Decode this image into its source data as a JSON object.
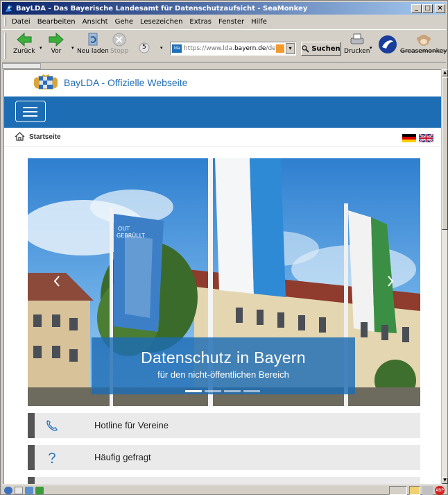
{
  "window": {
    "title": "BayLDA - Das Bayerische Landesamt für Datenschutzaufsicht - SeaMonkey",
    "buttons": {
      "minimize": "_",
      "maximize": "□",
      "close": "×"
    }
  },
  "menu": {
    "items": [
      "Datei",
      "Bearbeiten",
      "Ansicht",
      "Gehe",
      "Lesezeichen",
      "Extras",
      "Fenster",
      "Hilfe"
    ]
  },
  "toolbar": {
    "back": "Zurück",
    "forward": "Vor",
    "reload": "Neu laden",
    "stop": "Stopp",
    "history_count": "5",
    "url_prefix": "https://www.lda.",
    "url_domain": "bayern.de",
    "url_suffix": "/de",
    "search": "Suchen",
    "print": "Drucken",
    "greasemonkey": "Greasemonkey"
  },
  "page": {
    "site_title": "BayLDA - Offizielle Webseite",
    "breadcrumb": "Startseite",
    "hero": {
      "heading": "Datenschutz in Bayern",
      "subheading": "für den nicht-öffentlichen Bereich",
      "flag_text_line1": "OUT",
      "flag_text_line2": "GEBRÜLLT",
      "slides": 4,
      "active_slide": 1
    },
    "quick_links": [
      {
        "label": "Hotline für Vereine",
        "icon": "phone-icon"
      },
      {
        "label": "Häufig gefragt",
        "icon": "question-icon"
      }
    ]
  },
  "colors": {
    "brand_blue": "#1d6db5",
    "quicklink_bg": "#eaeaea",
    "quicklink_border": "#555555"
  }
}
